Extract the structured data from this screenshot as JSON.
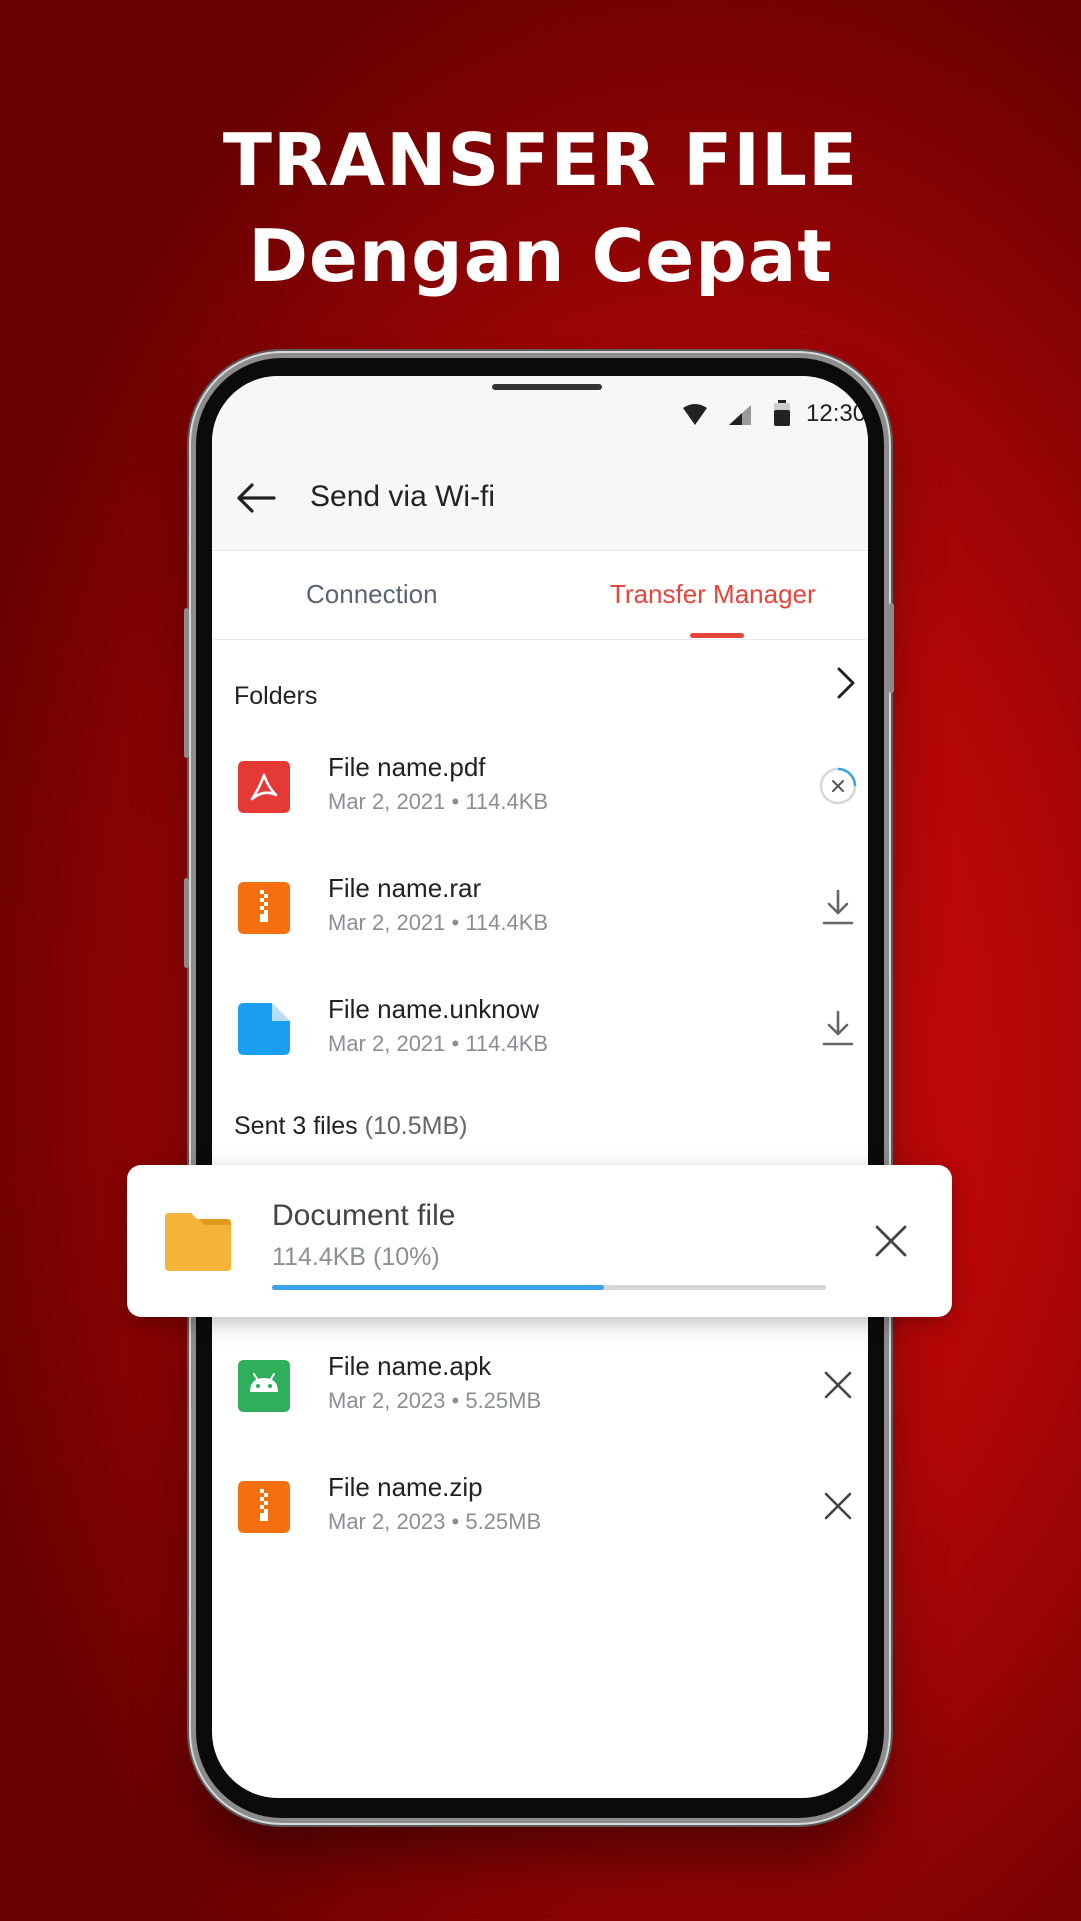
{
  "headline": {
    "line1": "TRANSFER FILE",
    "line2": "Dengan Cepat"
  },
  "status_bar": {
    "time": "12:30"
  },
  "app_bar": {
    "title": "Send via Wi-fi"
  },
  "tabs": [
    {
      "label": "Connection",
      "active": false
    },
    {
      "label": "Transfer Manager",
      "active": true
    }
  ],
  "folders_section": {
    "title": "Folders"
  },
  "received_files": [
    {
      "name": "File name.pdf",
      "meta": "Mar 2, 2021 • 114.4KB",
      "icon": "pdf-icon",
      "color": "#e53935",
      "action": "cancel-progress-icon"
    },
    {
      "name": "File name.rar",
      "meta": "Mar 2, 2021 • 114.4KB",
      "icon": "archive-icon",
      "color": "#f4700e",
      "action": "download-icon"
    },
    {
      "name": "File name.unknow",
      "meta": "Mar 2, 2021 • 114.4KB",
      "icon": "file-icon",
      "color": "#1a9ef0",
      "action": "download-icon"
    }
  ],
  "sent_section": {
    "title": "Sent 3 files",
    "size": "(10.5MB)"
  },
  "transfer_card": {
    "title": "Document file",
    "subtitle": "114.4KB (10%)",
    "progress": 0.6,
    "icon": "folder-icon",
    "icon_color": "#f4b43a",
    "accent": "#3aa3e8"
  },
  "sent_files": [
    {
      "name": "File name.apk",
      "meta": "Mar 2, 2023 • 5.25MB",
      "icon": "android-icon",
      "color": "#2fae5b",
      "action": "close-icon"
    },
    {
      "name": "File name.zip",
      "meta": "Mar 2, 2023 • 5.25MB",
      "icon": "archive-icon",
      "color": "#f4700e",
      "action": "close-icon"
    }
  ],
  "colors": {
    "accent": "#e5463a",
    "background": "#b30707"
  }
}
